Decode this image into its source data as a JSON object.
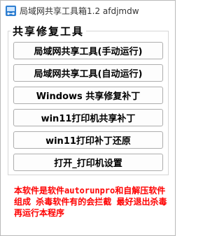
{
  "window": {
    "title": "局域网共享工具箱1.2   afdjmdw",
    "icon": "network-toolbox-icon"
  },
  "group": {
    "title": "共享修复工具"
  },
  "buttons": [
    {
      "label": "局域网共享工具(手动运行)"
    },
    {
      "label": "局域网共享工具(自动运行)"
    },
    {
      "label": "Windows 共享修复补丁"
    },
    {
      "label": "win11打印机共享补丁"
    },
    {
      "label": "win11打印补丁还原"
    },
    {
      "label": "打开_打印机设置"
    }
  ],
  "note": {
    "text": "本软件是软件autorunpro和自解压软件组成 杀毒软件有的会拦截 最好退出杀毒再运行本程序",
    "color": "#ff0000"
  }
}
